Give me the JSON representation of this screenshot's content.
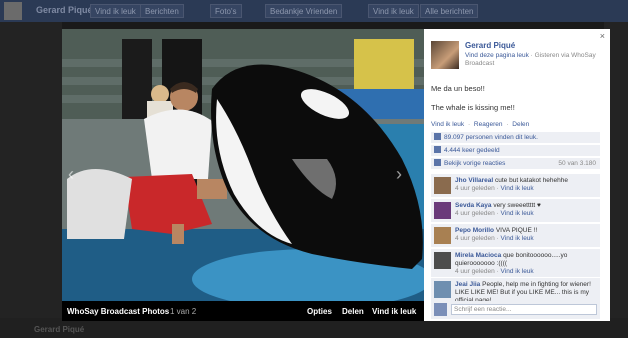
{
  "background": {
    "page_name": "Gerard Piqué",
    "tabs": [
      "Vind ik leuk",
      "Berichten",
      "Foto's",
      "Bedankje Vrienden"
    ],
    "right_actions": [
      "Vind ik leuk",
      "Alle berichten"
    ],
    "bottom_text": "Gerard Piqué"
  },
  "viewer": {
    "album_title": "WhoSay Broadcast Photos",
    "counter": "1 van 2",
    "actions": [
      "Opties",
      "Delen",
      "Vind ik leuk"
    ],
    "prev_arrow": "‹",
    "next_arrow": "›"
  },
  "panel": {
    "close": "×",
    "author": "Gerard Piqué",
    "like_page": "Vind deze pagina leuk",
    "meta": " · Gisteren via WhoSay Broadcast",
    "post_line1": "Me da un beso!!",
    "post_line2": "The whale is kissing me!!",
    "actions": [
      "Vind ik leuk",
      "·",
      "Reageren",
      "·",
      "Delen"
    ],
    "likes": "89.097 personen vinden dit leuk.",
    "shares": "4.444 keer gedeeld",
    "prev_comments": "Bekijk vorige reacties",
    "comment_count": "50 van 3.180",
    "comments": [
      {
        "name": "Jho Villareal",
        "text": "cute but katakot hehehhe",
        "time": "4 uur geleden",
        "like": "Vind ik leuk",
        "color": "#8a6b4e"
      },
      {
        "name": "Sevda Kaya",
        "text": "very sweeettttt ♥",
        "time": "4 uur geleden",
        "like": "Vind ik leuk",
        "color": "#6a3a7a"
      },
      {
        "name": "Pepo Morillo",
        "text": "VIVA PIQUE !!",
        "time": "4 uur geleden",
        "like": "Vind ik leuk",
        "color": "#a88052"
      },
      {
        "name": "Mirela Macioca",
        "text": "que bonitoooooo.....yo quierooooooo :((((",
        "time": "4 uur geleden",
        "like": "Vind ik leuk",
        "color": "#4d4d4d"
      },
      {
        "name": "Jeai Jiia",
        "text": "People, help me in fighting for wiener! LIKE LIKE ME! But if you LIKE ME... this is my official page!",
        "time": "",
        "like": "",
        "color": "#6f8fb0"
      }
    ],
    "write_placeholder": "Schrijf een reactie..."
  }
}
